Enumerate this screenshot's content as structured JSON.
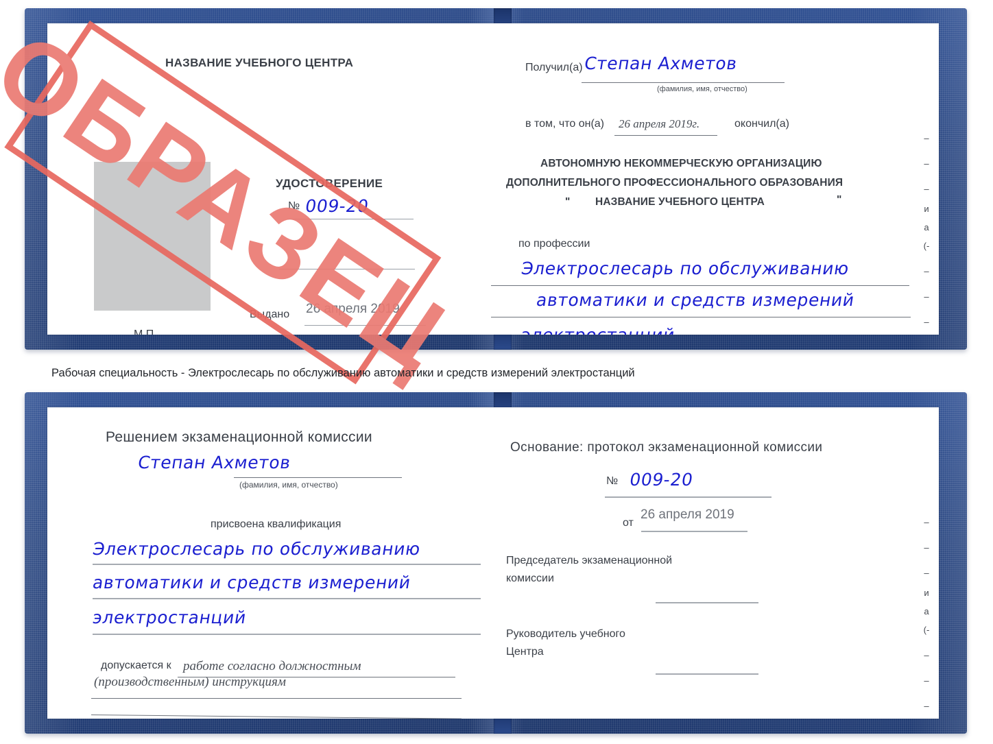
{
  "document": {
    "type": "Удостоверение",
    "caption": "Рабочая специальность - Электрослесарь по обслуживанию автоматики и средств измерений электростанций",
    "watermark": {
      "text": "ОБРАЗЕЦ",
      "color": "#eb7a72"
    },
    "cover_color": "#27447f",
    "handwriting_color": "#1b1fd0"
  },
  "certificate_top": {
    "left_page": {
      "org_title": "НАЗВАНИЕ УЧЕБНОГО ЦЕНТРА",
      "doc_title": "УДОСТОВЕРЕНИЕ",
      "number_label": "№",
      "number_value": "009-20",
      "issued_label": "Выдано",
      "issued_value": "26 апреля 2019",
      "seal_label": "М.П.",
      "photo_placeholder": "photo-placeholder"
    },
    "right_page": {
      "received_label": "Получил(а)",
      "received_value": "Степан Ахметов",
      "name_hint": "(фамилия, имя, отчество)",
      "in_that_label": "в том, что он(а)",
      "completion_date": "26 апреля 2019г.",
      "finished_label": "окончил(а)",
      "org_line1": "АВТОНОМНУЮ НЕКОММЕРЧЕСКУЮ ОРГАНИЗАЦИЮ",
      "org_line2": "ДОПОЛНИТЕЛЬНОГО ПРОФЕССИОНАЛЬНОГО ОБРАЗОВАНИЯ",
      "org_quote_open": "\"",
      "org_line3": "НАЗВАНИЕ УЧЕБНОГО ЦЕНТРА",
      "org_quote_close": "\"",
      "profession_label": "по профессии",
      "profession_line1": "Электрослесарь по обслуживанию",
      "profession_line2": "автоматики и средств измерений",
      "profession_line3": "электростанций"
    },
    "edge_marks": [
      "–",
      "–",
      "–",
      "и",
      "а",
      "(-",
      "–",
      "–",
      "–",
      "–"
    ]
  },
  "certificate_bottom": {
    "left_page": {
      "decision_title": "Решением экзаменационной комиссии",
      "name_value": "Степан Ахметов",
      "name_hint": "(фамилия, имя, отчество)",
      "qualification_label": "присвоена квалификация",
      "qualification_line1": "Электрослесарь по обслуживанию",
      "qualification_line2": "автоматики и средств измерений",
      "qualification_line3": "электростанций",
      "admitted_label": "допускается к",
      "admitted_line1": "работе согласно должностным",
      "admitted_line2": "(производственным) инструкциям"
    },
    "right_page": {
      "basis_label": "Основание: протокол экзаменационной комиссии",
      "number_label": "№",
      "number_value": "009-20",
      "date_label": "от",
      "date_value": "26 апреля 2019",
      "chairman_line1": "Председатель экзаменационной",
      "chairman_line2": "комиссии",
      "head_line1": "Руководитель учебного",
      "head_line2": "Центра"
    },
    "edge_marks": [
      "–",
      "–",
      "–",
      "и",
      "а",
      "(-",
      "–",
      "–",
      "–",
      "–"
    ]
  }
}
